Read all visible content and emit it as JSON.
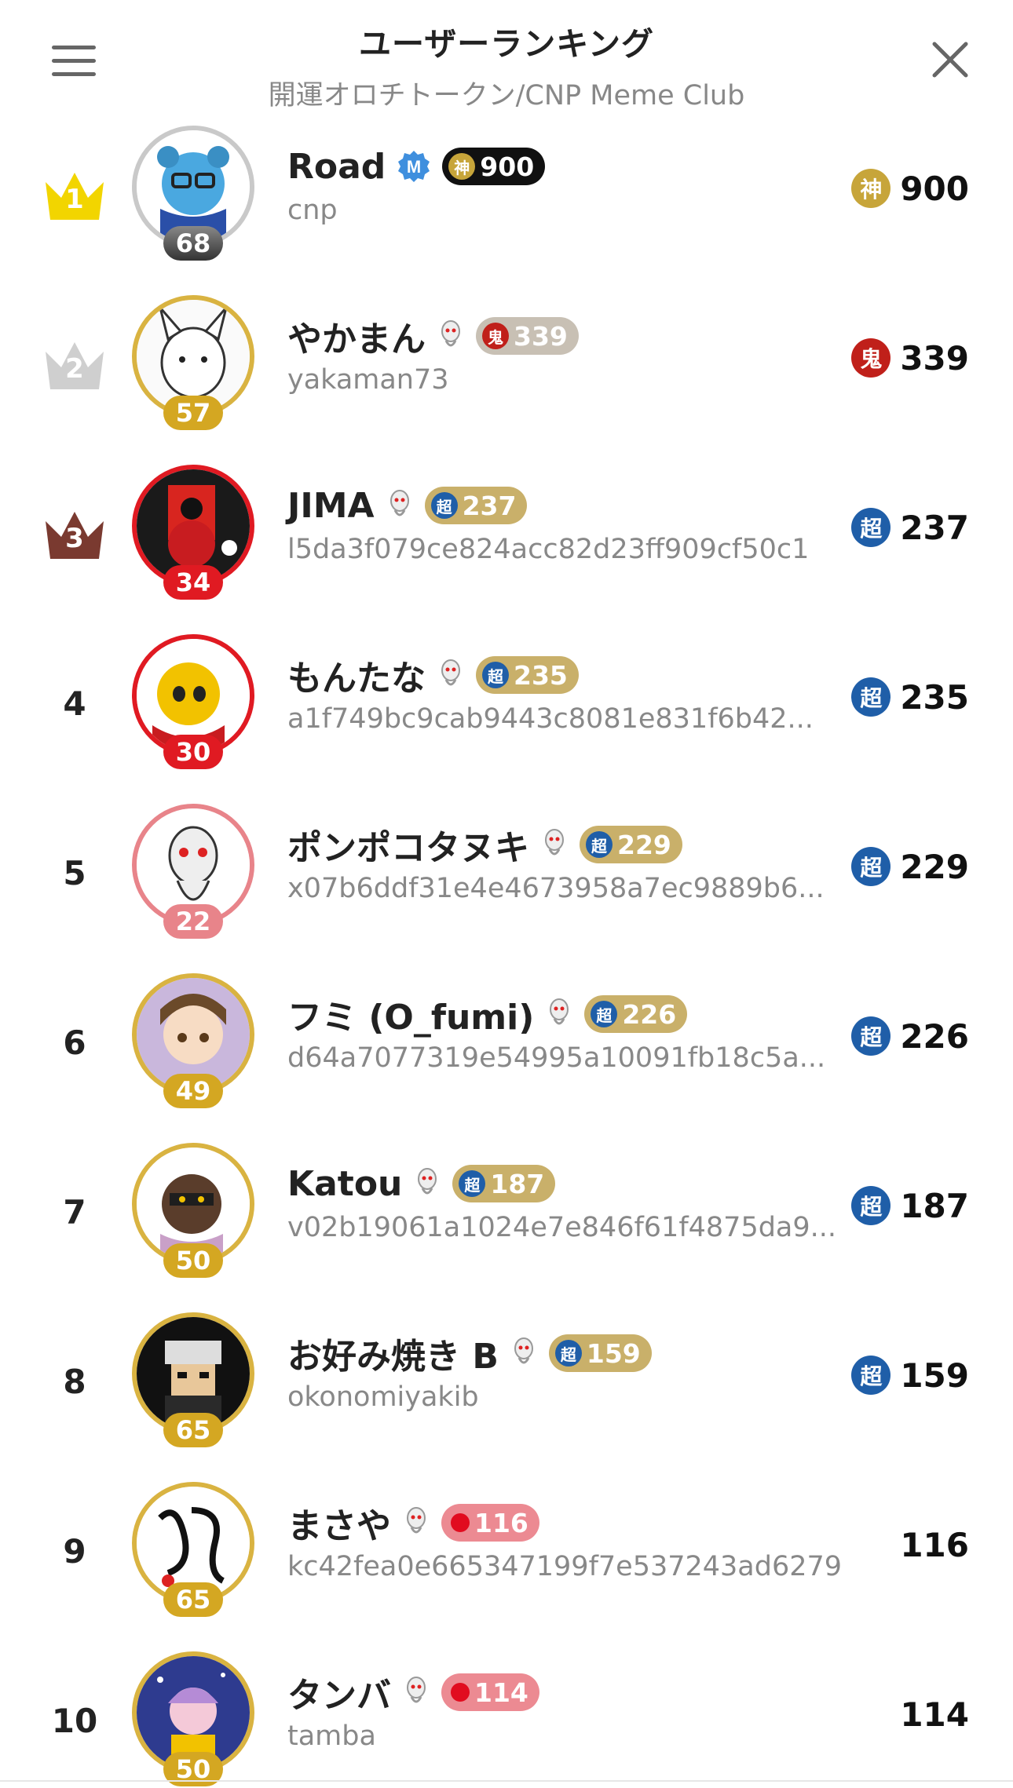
{
  "header": {
    "title": "ユーザーランキング",
    "subtitle": "開運オロチトークン/CNP Meme Club"
  },
  "colors": {
    "gold_crown": "#f2d500",
    "silver_crown": "#cfcfcf",
    "bronze_crown": "#7a3a30",
    "kami_coin": "#c7a53a",
    "oni_coin": "#c0201a",
    "cho_coin": "#1f5ea8",
    "red_dot": "#e10c1f",
    "level_gold": "#d4a722",
    "level_red": "#e01a22",
    "level_pink": "#e8848a"
  },
  "users": [
    {
      "rank": "1",
      "name": "Road",
      "handle": "cnp",
      "level": "68",
      "tier_glyph": "神",
      "pill_value": "900",
      "score": "900",
      "verified": true
    },
    {
      "rank": "2",
      "name": "やかまん",
      "handle": "yakaman73",
      "level": "57",
      "tier_glyph": "鬼",
      "pill_value": "339",
      "score": "339",
      "verified": false
    },
    {
      "rank": "3",
      "name": "JIMA",
      "handle": "l5da3f079ce824acc82d23ff909cf50c1",
      "level": "34",
      "tier_glyph": "超",
      "pill_value": "237",
      "score": "237",
      "verified": false
    },
    {
      "rank": "4",
      "name": "もんたな",
      "handle": "a1f749bc9cab9443c8081e831f6b42...",
      "level": "30",
      "tier_glyph": "超",
      "pill_value": "235",
      "score": "235",
      "verified": false
    },
    {
      "rank": "5",
      "name": "ポンポコタヌキ",
      "handle": "x07b6ddf31e4e4673958a7ec9889b6...",
      "level": "22",
      "tier_glyph": "超",
      "pill_value": "229",
      "score": "229",
      "verified": false
    },
    {
      "rank": "6",
      "name": "フミ (O_fumi)",
      "handle": "d64a7077319e54995a10091fb18c5a...",
      "level": "49",
      "tier_glyph": "超",
      "pill_value": "226",
      "score": "226",
      "verified": false
    },
    {
      "rank": "7",
      "name": "Katou",
      "handle": "v02b19061a1024e7e846f61f4875da9...",
      "level": "50",
      "tier_glyph": "超",
      "pill_value": "187",
      "score": "187",
      "verified": false
    },
    {
      "rank": "8",
      "name": "お好み焼き B",
      "handle": "okonomiyakib",
      "level": "65",
      "tier_glyph": "超",
      "pill_value": "159",
      "score": "159",
      "verified": false
    },
    {
      "rank": "9",
      "name": "まさや",
      "handle": "kc42fea0e665347199f7e537243ad6279",
      "level": "65",
      "tier_glyph": "",
      "pill_value": "116",
      "score": "116",
      "verified": false
    },
    {
      "rank": "10",
      "name": "タンバ",
      "handle": "tamba",
      "level": "50",
      "tier_glyph": "",
      "pill_value": "114",
      "score": "114",
      "verified": false
    }
  ]
}
